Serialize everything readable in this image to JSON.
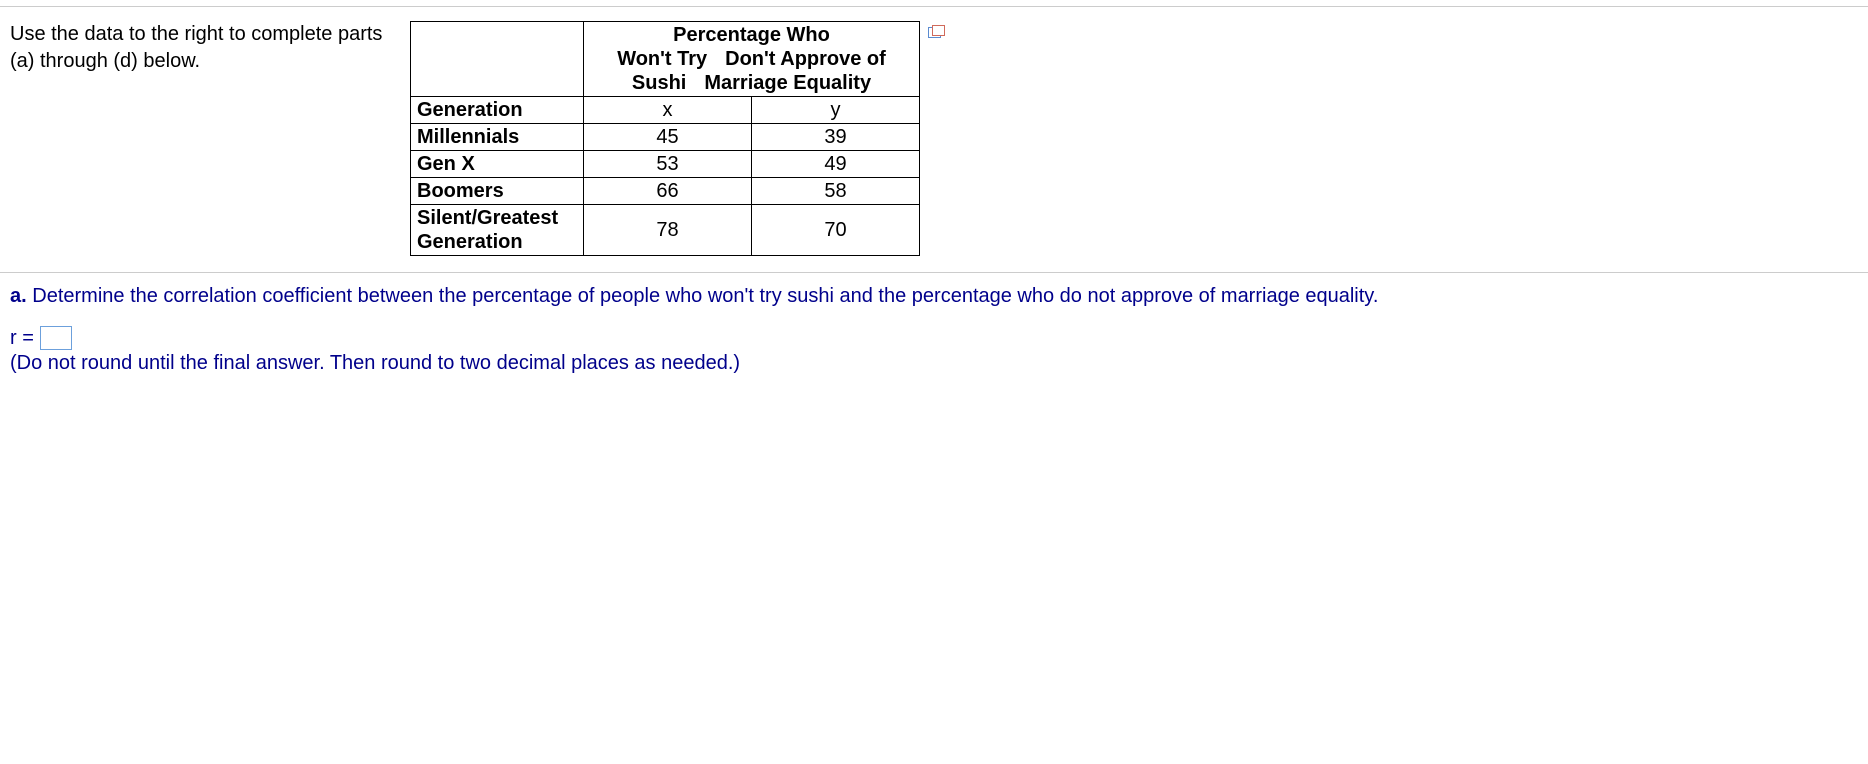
{
  "instructions": "Use the data to the right to complete parts (a) through (d) below.",
  "table": {
    "super_header": "Percentage Who",
    "col1_line1": "Won't Try",
    "col1_line2": "Sushi",
    "col2_line1": "Don't Approve of",
    "col2_line2": "Marriage Equality",
    "generation_label": "Generation",
    "x_label": "x",
    "y_label": "y",
    "rows": [
      {
        "gen": "Millennials",
        "x": "45",
        "y": "39"
      },
      {
        "gen": "Gen X",
        "x": "53",
        "y": "49"
      },
      {
        "gen": "Boomers",
        "x": "66",
        "y": "58"
      },
      {
        "gen": "Silent/Greatest Generation",
        "x": "78",
        "y": "70"
      }
    ]
  },
  "question": {
    "part_label": "a.",
    "text": "Determine the correlation coefficient between the percentage of people who won't try sushi and the percentage who do not approve of marriage equality.",
    "r_label": "r =",
    "hint": "(Do not round until the final answer. Then round to two decimal places as needed.)"
  },
  "chart_data": {
    "type": "table",
    "title": "Percentage Who Won't Try Sushi vs Don't Approve of Marriage Equality",
    "columns": [
      "Generation",
      "Won't Try Sushi (x)",
      "Don't Approve of Marriage Equality (y)"
    ],
    "rows": [
      [
        "Millennials",
        45,
        39
      ],
      [
        "Gen X",
        53,
        49
      ],
      [
        "Boomers",
        66,
        58
      ],
      [
        "Silent/Greatest Generation",
        78,
        70
      ]
    ]
  }
}
